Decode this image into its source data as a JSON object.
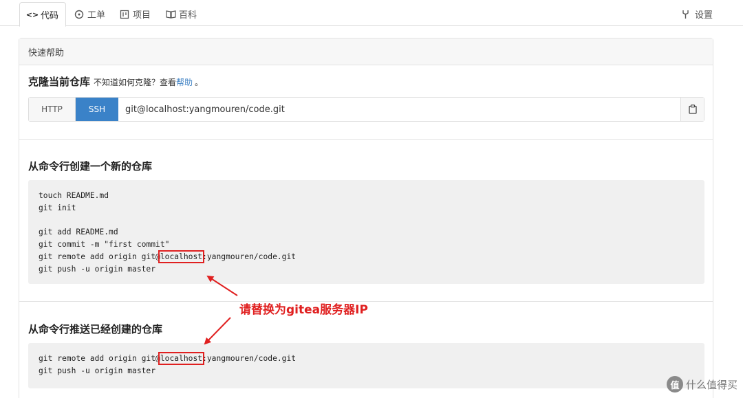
{
  "tabs": [
    {
      "icon": "code-icon",
      "glyph": "<>",
      "label": "代码",
      "active": true
    },
    {
      "icon": "issue-icon",
      "glyph": "⊙",
      "label": "工单",
      "active": false
    },
    {
      "icon": "project-icon",
      "glyph": "▦",
      "label": "项目",
      "active": false
    },
    {
      "icon": "wiki-icon",
      "glyph": "▯▯",
      "label": "百科",
      "active": false
    }
  ],
  "settings": {
    "icon": "wrench-icon",
    "label": "设置"
  },
  "panel": {
    "header": "快速帮助",
    "clone": {
      "title": "克隆当前仓库",
      "hint": "不知道如何克隆？查看",
      "help_link": "帮助",
      "punct": "。",
      "http_label": "HTTP",
      "ssh_label": "SSH",
      "url": "git@localhost:yangmouren/code.git"
    },
    "new_repo": {
      "title": "从命令行创建一个新的仓库",
      "lines": [
        "touch README.md",
        "git init",
        "",
        "git add README.md",
        "git commit -m \"first commit\"",
        "git remote add origin git@",
        "git push -u origin master"
      ],
      "highlight": "localhost",
      "remote_suffix": ":yangmouren/code.git"
    },
    "push_repo": {
      "title": "从命令行推送已经创建的仓库",
      "line1_prefix": "git remote add origin git@",
      "highlight": "localhost",
      "line1_suffix": ":yangmouren/code.git",
      "line2": "git push -u origin master"
    }
  },
  "annotation": "请替换为gitea服务器IP",
  "watermark": {
    "logo": "值",
    "text": "什么值得买"
  },
  "colors": {
    "accent": "#3a82c8",
    "annotation": "#e02020"
  }
}
